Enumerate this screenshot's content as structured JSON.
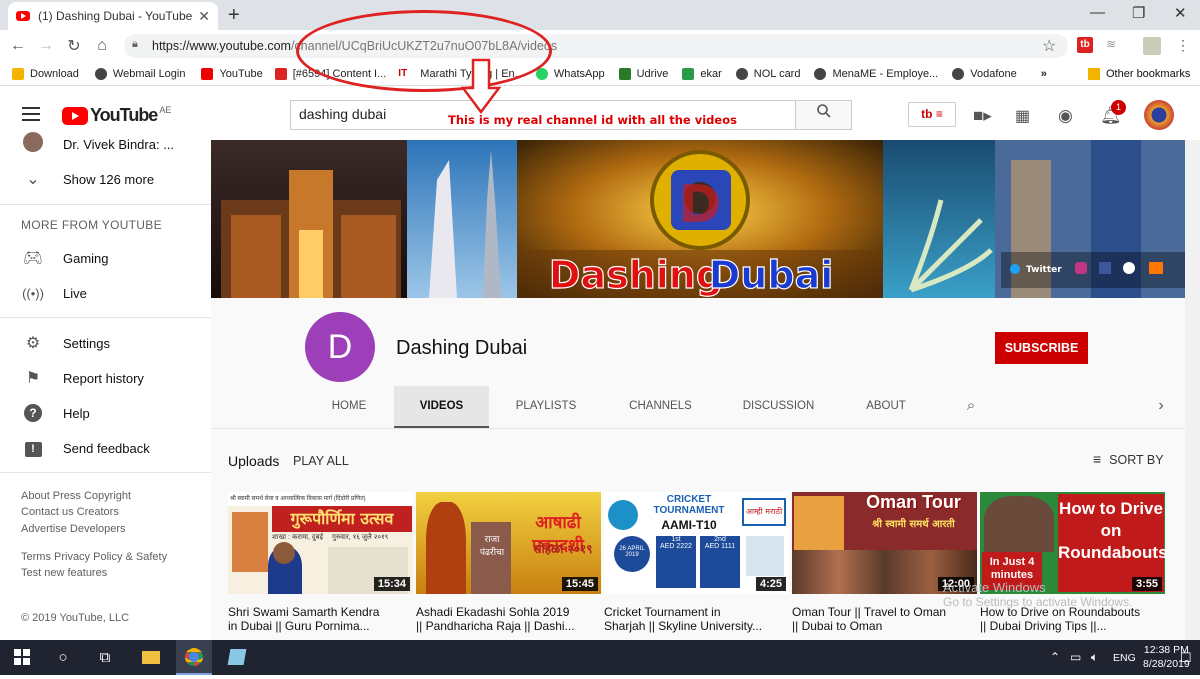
{
  "browser": {
    "tab_title": "(1) Dashing Dubai - YouTube",
    "url_host": "https://www.youtube.com",
    "url_path": "/channel/UCqBriUcUKZT2u7nuO07bL8A/videos"
  },
  "bookmarks": {
    "items": [
      "Download",
      "Webmail Login",
      "YouTube",
      "[#6594] Content I...",
      "Marathi Typing | En...",
      "WhatsApp",
      "Udrive",
      "ekar",
      "NOL card",
      "MenaME - Employe...",
      "Vodafone"
    ],
    "more": "»",
    "other": "Other bookmarks"
  },
  "youtube": {
    "logo_text": "YouTube",
    "region": "AE",
    "search_value": "dashing dubai",
    "notification_count": "1"
  },
  "annotation": {
    "note": "This is my real channel id with all the videos"
  },
  "sidebar": {
    "subscription": "Dr. Vivek Bindra: ...",
    "show_more": "Show 126 more",
    "more_heading": "MORE FROM YOUTUBE",
    "more_items": [
      "Gaming",
      "Live"
    ],
    "settings_items": [
      "Settings",
      "Report history",
      "Help",
      "Send feedback"
    ],
    "footer1": "About  Press  Copyright",
    "footer2": "Contact us  Creators",
    "footer3": "Advertise  Developers",
    "footer4": "Terms  Privacy  Policy & Safety",
    "footer5": "Test new features",
    "copyright": "© 2019 YouTube, LLC"
  },
  "banner": {
    "title1": "Dashing",
    "title2": "Dubai",
    "logo_letter": "D",
    "twitter": "Twitter"
  },
  "channel": {
    "avatar_letter": "D",
    "name": "Dashing Dubai",
    "subscribe": "SUBSCRIBE",
    "tabs": [
      "HOME",
      "VIDEOS",
      "PLAYLISTS",
      "CHANNELS",
      "DISCUSSION",
      "ABOUT"
    ],
    "active_tab": "VIDEOS"
  },
  "uploads": {
    "heading": "Uploads",
    "play_all": "PLAY ALL",
    "sort_by": "SORT BY",
    "videos": [
      {
        "duration": "15:34",
        "title1": "Shri Swami Samarth Kendra",
        "title2": "in Dubai || Guru Pornima...",
        "thumb_text1": "श्री स्वामी समर्थ सेवा व आध्यात्मिक विकास मार्ग (दिंडोरी प्रणित)",
        "thumb_text2": "गुरूपौर्णिमा उत्सव",
        "thumb_text3": "शाखा : करामा, दुबई",
        "thumb_text4": "गुरुवार, १६ जुलै २०१९"
      },
      {
        "duration": "15:45",
        "title1": "Ashadi Ekadashi Sohla 2019",
        "title2": "|| Pandharicha Raja || Dashi...",
        "thumb_text1": "आषाढी एकादशी",
        "thumb_text2": "सोहळा २०१९",
        "thumb_text3": "राजा पंढरीचा"
      },
      {
        "duration": "4:25",
        "title1": "Cricket Tournament in",
        "title2": "Sharjah || Skyline University...",
        "thumb_text1": "CRICKET TOURNAMENT",
        "thumb_text2": "AAMI-T10",
        "thumb_text3": "26 APRIL 2019",
        "thumb_text4": "1st",
        "thumb_text5": "2nd",
        "thumb_text6": "AED 2222",
        "thumb_text7": "AED 1111",
        "thumb_text8": "आम्ही मराठी"
      },
      {
        "duration": "12:00",
        "title1": "Oman Tour || Travel to Oman",
        "title2": "|| Dubai to Oman",
        "thumb_text1": "Oman Tour",
        "thumb_text2": "श्री स्वामी समर्थ आरती"
      },
      {
        "duration": "3:55",
        "title1": "How to Drive on Roundabouts",
        "title2": "|| Dubai Driving Tips ||...",
        "thumb_text1": "How to Drive on Roundabouts",
        "thumb_text2": "In Just 4 minutes"
      }
    ]
  },
  "watermark": {
    "line1": "Activate Windows",
    "line2": "Go to Settings to activate Windows."
  },
  "taskbar": {
    "lang": "ENG",
    "time": "12:38 PM",
    "date": "8/28/2019"
  }
}
